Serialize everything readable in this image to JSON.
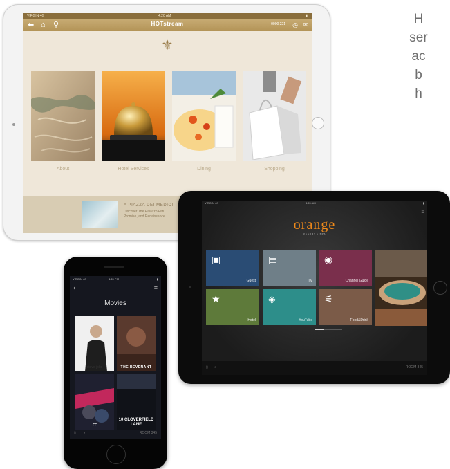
{
  "side_text": [
    "H",
    "ser",
    "ac",
    "b",
    "h"
  ],
  "tablet_white": {
    "status": {
      "carrier": "VIRGIN 4G",
      "time": "4:20 AM"
    },
    "nav": {
      "brand": "HOTstream",
      "phone": "+0000 221"
    },
    "tiles": [
      {
        "label": "About"
      },
      {
        "label": "Hotel Services"
      },
      {
        "label": "Dining"
      },
      {
        "label": "Shopping"
      }
    ],
    "banner": {
      "title": "A PIAZZA DEI MEDICI",
      "line1": "Discover The Palazzo Pitti...",
      "line2": "Promise, and Renaissance..."
    }
  },
  "tablet_black": {
    "status": {
      "carrier": "VIRGIN 4G",
      "time": "4:20 AM"
    },
    "logo": {
      "name": "orange",
      "sub": "RESORT • SPA"
    },
    "tiles": [
      {
        "label": "Guest",
        "icon": "briefcase-icon",
        "color": "#2a4c74"
      },
      {
        "label": "TV",
        "icon": "tv-icon",
        "color": "#6f7f88"
      },
      {
        "label": "Channel Guide",
        "icon": "eye-icon",
        "color": "#7a2f4c"
      },
      {
        "label": "Hotel",
        "icon": "star-icon",
        "color": "#5e7a3a"
      },
      {
        "label": "YouTube",
        "icon": "tag-icon",
        "color": "#2d8e8a"
      },
      {
        "label": "Food&Drink",
        "icon": "cutlery-icon",
        "color": "#7b5b48"
      }
    ],
    "room": "ROOM 345"
  },
  "phone": {
    "status": {
      "carrier": "VIRGIN 4G",
      "time": "4:20 PM"
    },
    "title": "Movies",
    "posters": [
      {
        "title": "steve jobs"
      },
      {
        "title": "THE REVENANT"
      },
      {
        "title": "FF"
      },
      {
        "title": "10 CLOVERFIELD LANE"
      }
    ],
    "room": "ROOM 345"
  }
}
